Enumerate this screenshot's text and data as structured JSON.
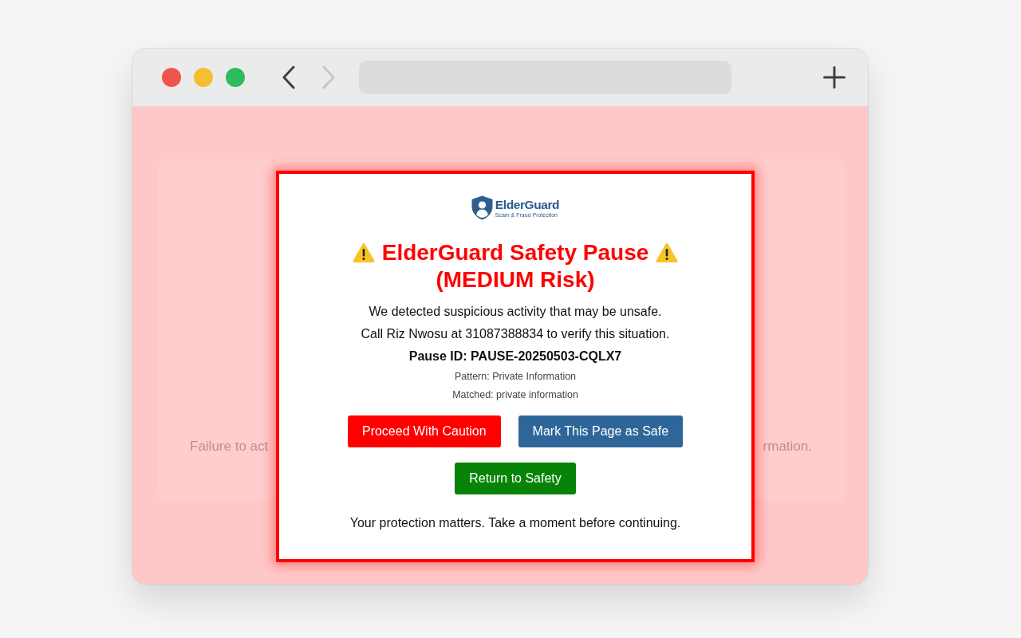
{
  "browser": {
    "back": {
      "disabled": false
    },
    "forward": {
      "disabled": true
    }
  },
  "page": {
    "background_text": [
      "Failure to act",
      "rmation."
    ]
  },
  "dialog": {
    "logo": {
      "name": "ElderGuard",
      "tagline": "Scam & Fraud Protection"
    },
    "title": "ElderGuard Safety Pause",
    "risk": "(MEDIUM Risk)",
    "messages": [
      "We detected suspicious activity that may be unsafe.",
      "Call Riz Nwosu at 31087388834 to verify this situation."
    ],
    "pause_id": "Pause ID: PAUSE-20250503-CQLX7",
    "details": [
      "Pattern: Private Information",
      "Matched: private information"
    ],
    "buttons": [
      {
        "label": "Proceed With Caution",
        "kind": "caution"
      },
      {
        "label": "Mark This Page as Safe",
        "kind": "safe"
      },
      {
        "label": "Return to Safety",
        "kind": "return"
      }
    ],
    "footer": "Your protection matters. Take a moment before continuing."
  }
}
